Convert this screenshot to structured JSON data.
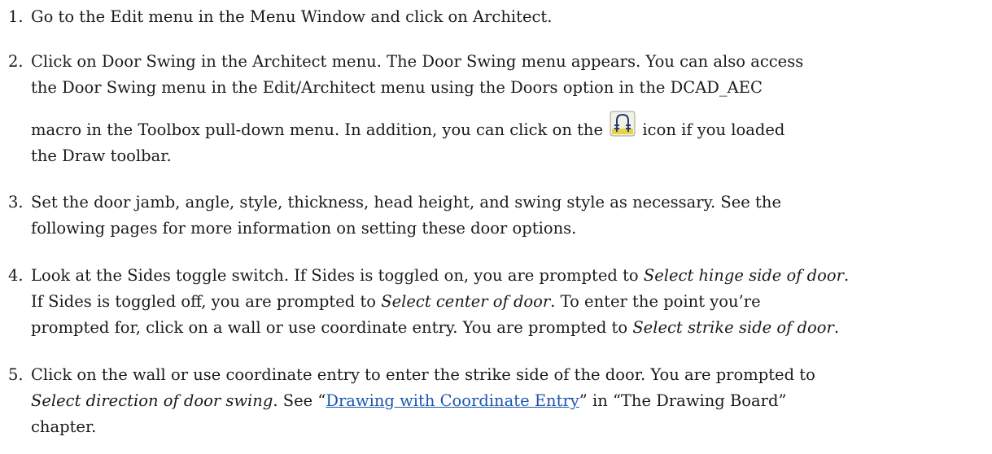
{
  "steps": [
    {
      "number": "1.",
      "text": "Go to the Edit menu in the Menu Window and click on Architect."
    },
    {
      "number": "2.",
      "line1": "Click on Door Swing in the Architect menu. The Door Swing menu appears. You can also access",
      "line2": "the Door Swing menu in the Edit/Architect menu using the Doors option in the DCAD_AEC",
      "line3_before_icon": "macro in the Toolbox pull-down menu. In addition, you can click on the",
      "line3_after_icon": "icon if you loaded",
      "line4": "the Draw toolbar.",
      "icon": "door-swing-icon"
    },
    {
      "number": "3.",
      "line1": "Set the door jamb, angle, style, thickness, head height, and swing style as necessary. See the",
      "line2": "following pages for more information on setting these door options."
    },
    {
      "number": "4.",
      "line1_a": "Look at the Sides toggle switch. If Sides is toggled on, you are prompted to ",
      "line1_em": "Select hinge side of door",
      "line1_b": ".",
      "line2_a": "If Sides is toggled off, you are prompted to ",
      "line2_em": "Select center of door",
      "line2_b": ". To enter the point you’re",
      "line3_a": "prompted for, click on a wall or use coordinate entry. You are prompted to ",
      "line3_em": "Select strike side of door",
      "line3_b": "."
    },
    {
      "number": "5.",
      "line1": "Click on the wall or use coordinate entry to enter the strike side of the door. You are prompted to",
      "line2_em": "Select direction of door swing",
      "line2_a": ". See “",
      "line2_link": "Drawing with Coordinate Entry",
      "line2_b": "” in “The Drawing Board”",
      "line3": "chapter."
    }
  ],
  "colors": {
    "text": "#1a1a1a",
    "link": "#1a56b0",
    "icon_bg": "#e8d24a"
  }
}
